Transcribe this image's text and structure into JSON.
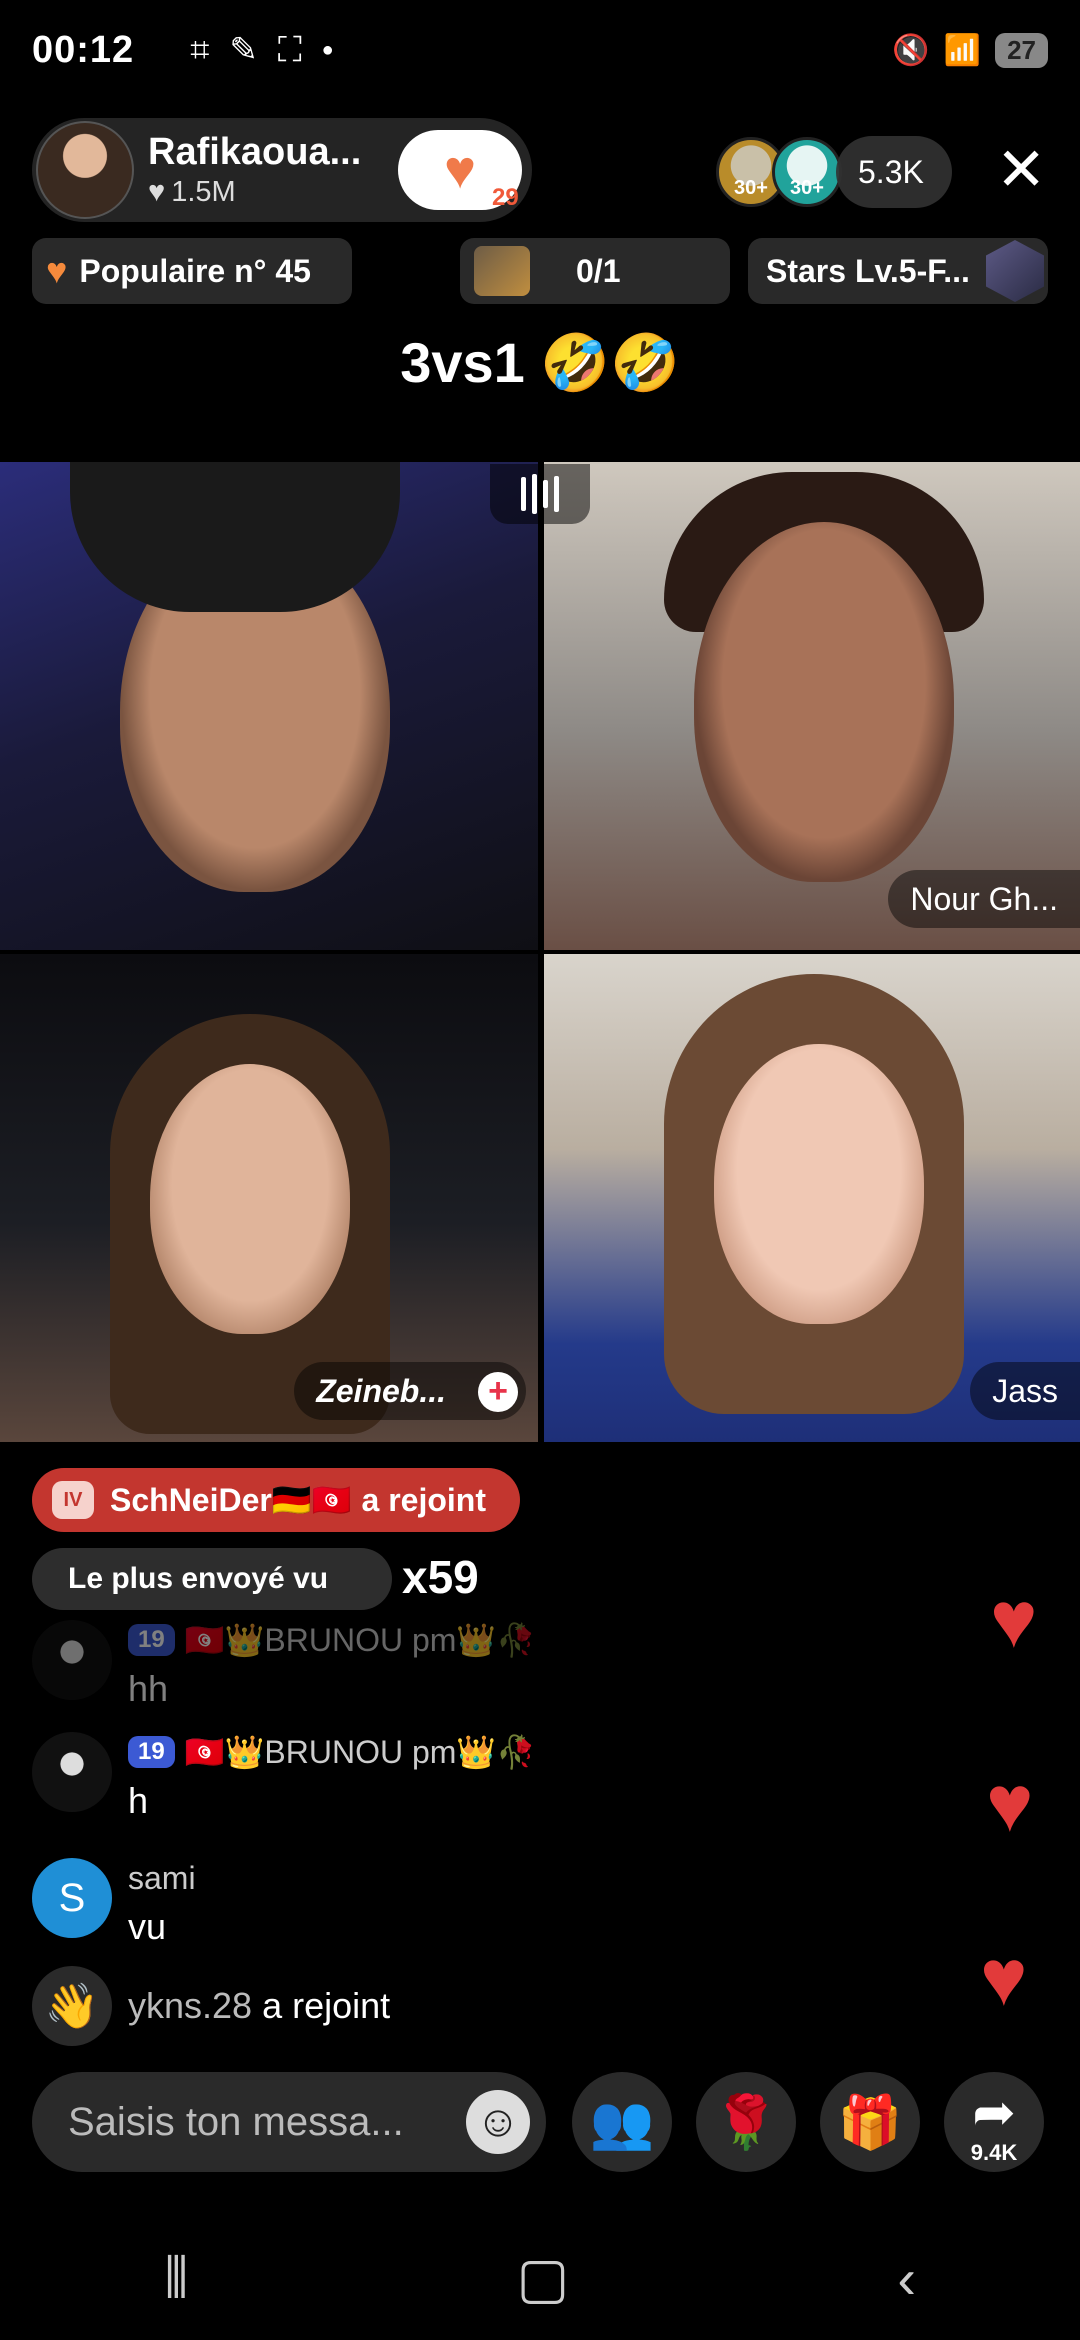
{
  "status_bar": {
    "time": "00:12",
    "battery": "27",
    "icons": [
      "screen-record-icon",
      "edit-icon",
      "screenshot-icon",
      "mute-icon",
      "wifi-icon",
      "signal-icon",
      "battery-icon"
    ]
  },
  "host": {
    "name": "Rafikaoua...",
    "likes": "1.5M",
    "follow_badge_count": "29"
  },
  "viewers": {
    "badge1": "30+",
    "badge2": "30+",
    "count": "5.3K"
  },
  "info_chips": {
    "popular": "Populaire n° 45",
    "rank": "0/1",
    "stars": "Stars Lv.5-F..."
  },
  "stream_title": "3vs1 🤣🤣",
  "tiles": [
    {
      "label": ""
    },
    {
      "label": "Nour Gh..."
    },
    {
      "label": "Zeineb..."
    },
    {
      "label": "Jass"
    }
  ],
  "join_banner": {
    "level": "IV",
    "user": "SchNeiDer🇩🇪🇹🇳",
    "suffix": "a rejoint"
  },
  "most_sent": {
    "label": "Le plus envoyé vu",
    "count": "x59"
  },
  "comments": [
    {
      "level": "19",
      "user": "🇹🇳👑BRUNOU pm👑🥀",
      "text": "hh"
    },
    {
      "level": "19",
      "user": "🇹🇳👑BRUNOU pm👑🥀",
      "text": "h"
    },
    {
      "avatar_letter": "S",
      "user": "sami",
      "text": "vu"
    },
    {
      "user": "ykns.28",
      "suffix": "a rejoint"
    }
  ],
  "input": {
    "placeholder": "Saisis ton messa..."
  },
  "share_count": "9.4K",
  "colors": {
    "accent_red": "#e23a3a",
    "banner_red": "#c3362f",
    "level_blue": "#3c5ad4",
    "popular_orange": "#f58a3c"
  }
}
